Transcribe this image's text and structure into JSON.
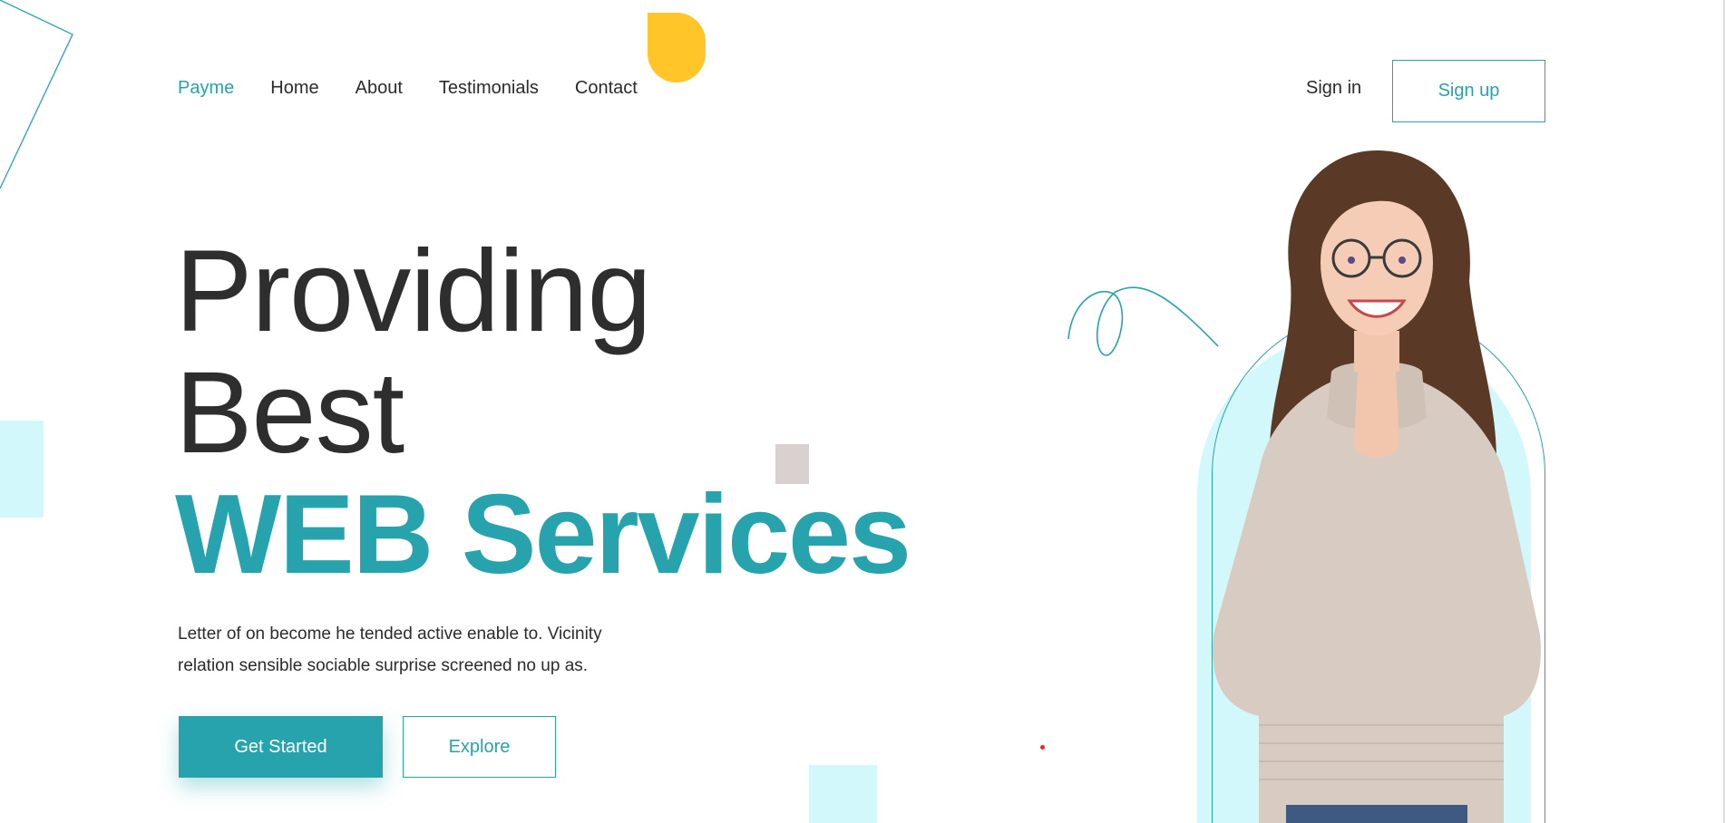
{
  "nav": {
    "brand": "Payme",
    "items": [
      {
        "label": "Home"
      },
      {
        "label": "About"
      },
      {
        "label": "Testimonials"
      },
      {
        "label": "Contact"
      }
    ],
    "signin_label": "Sign in",
    "signup_label": "Sign up"
  },
  "hero": {
    "line1": "Providing",
    "line2": "Best",
    "line3": "WEB Services",
    "description": "Letter of on become he tended active enable to. Vicinity relation sensible sociable surprise screened no up as.",
    "primary_cta": "Get Started",
    "secondary_cta": "Explore"
  },
  "colors": {
    "accent": "#27a3ad",
    "yellow": "#ffc529",
    "light_cyan": "#d2f8fb",
    "text": "#2b2b2b"
  }
}
